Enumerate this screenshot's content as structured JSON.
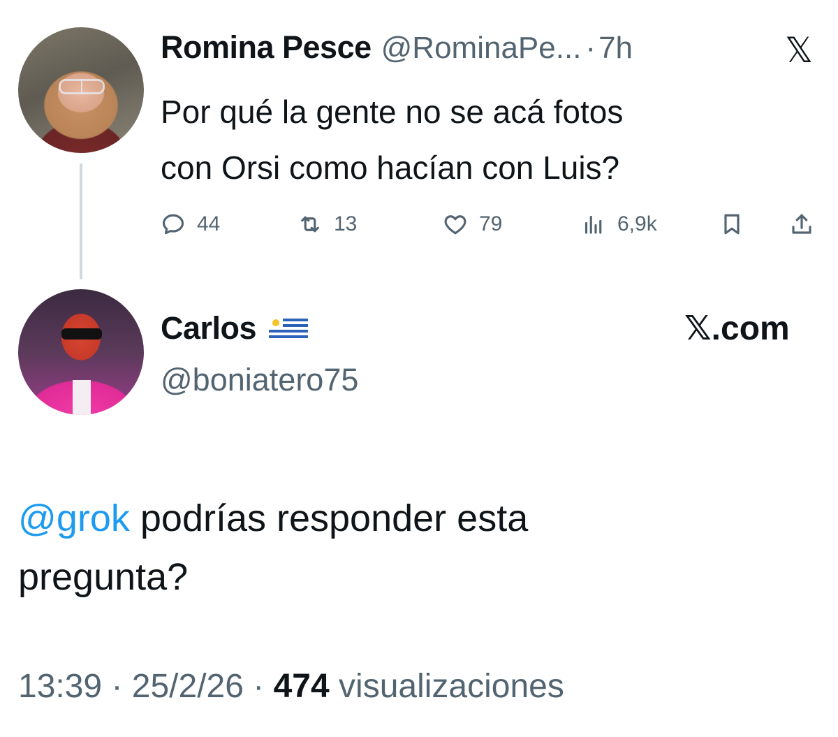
{
  "parent_tweet": {
    "author_name": "Romina Pesce",
    "author_handle": "@RominaPe...",
    "separator": "·",
    "time_ago": "7h",
    "platform_icon": "x-logo-icon",
    "platform_glyph": "𝕏",
    "text_line1": "Por qué la gente no se acá fotos",
    "text_line2": "con Orsi como hacían con Luis?",
    "actions": {
      "replies": "44",
      "reposts": "13",
      "likes": "79",
      "views": "6,9k"
    }
  },
  "reply_tweet": {
    "author_name": "Carlos",
    "flag_icon": "uruguay-flag-icon",
    "author_handle": "@boniatero75",
    "brand": "𝕏.com",
    "mention": "@grok",
    "text_line1_rest": " podrías responder esta",
    "text_line2": "pregunta?",
    "time": "13:39",
    "sep1": " · ",
    "date": "25/2/26",
    "sep2": " · ",
    "views_count": "474",
    "views_label": " visualizaciones"
  },
  "colors": {
    "text_primary": "#0f1419",
    "text_secondary": "#536471",
    "mention": "#1d9bf0",
    "thread_line": "#cfd9de"
  }
}
